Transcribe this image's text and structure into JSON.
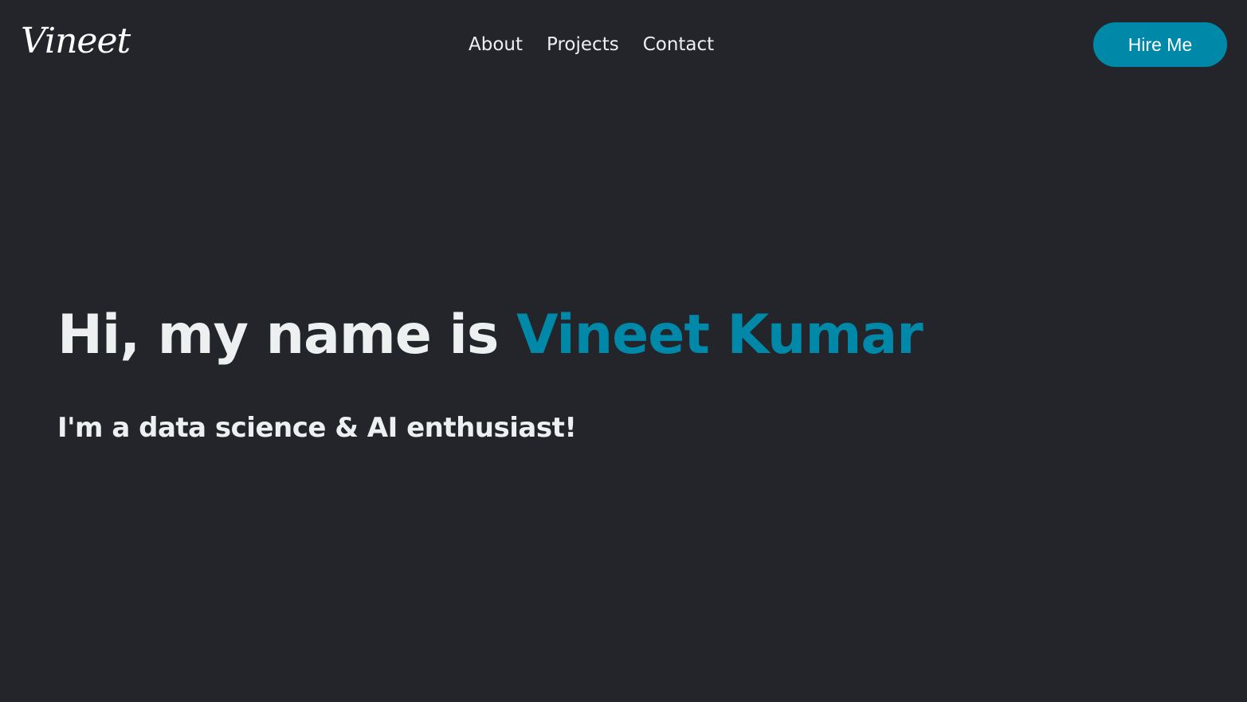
{
  "header": {
    "logo_text": "Vineet",
    "nav": [
      {
        "label": "About"
      },
      {
        "label": "Projects"
      },
      {
        "label": "Contact"
      }
    ],
    "cta_label": "Hire Me"
  },
  "hero": {
    "greeting": "Hi, my name is ",
    "name": "Vineet Kumar",
    "tagline": "I'm a data science & AI enthusiast!"
  },
  "colors": {
    "background": "#24252b",
    "accent": "#0088a9",
    "text": "#edf0f1"
  }
}
